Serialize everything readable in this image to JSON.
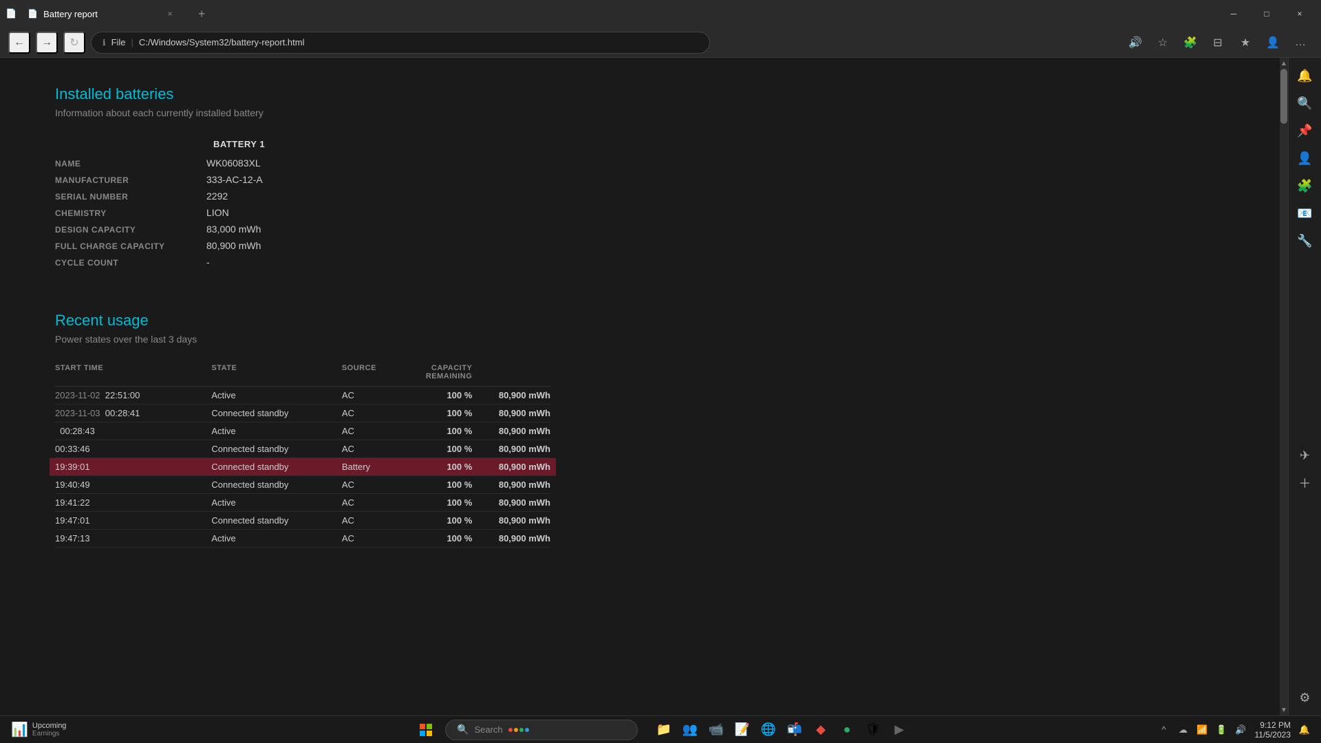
{
  "browser": {
    "tab": {
      "icon": "📄",
      "title": "Battery report",
      "close": "×"
    },
    "tab_new": "+",
    "address": {
      "lock_icon": "ℹ",
      "protocol": "File",
      "separator": "|",
      "path": "C:/Windows/System32/battery-report.html"
    },
    "nav": {
      "back": "←",
      "forward": "→",
      "refresh": "↻"
    },
    "toolbar": {
      "read_aloud": "🔊",
      "favorites": "☆",
      "extensions": "🧩",
      "split_view": "⊟",
      "collections": "★",
      "profile": "👤",
      "more": "…"
    },
    "title_controls": {
      "minimize": "─",
      "maximize": "□",
      "close": "×"
    }
  },
  "page": {
    "installed_batteries": {
      "title": "Installed batteries",
      "subtitle": "Information about each currently installed battery",
      "battery_header": "BATTERY 1",
      "rows": [
        {
          "label": "NAME",
          "value": "WK06083XL"
        },
        {
          "label": "MANUFACTURER",
          "value": "333-AC-12-A"
        },
        {
          "label": "SERIAL NUMBER",
          "value": "2292"
        },
        {
          "label": "CHEMISTRY",
          "value": "LION"
        },
        {
          "label": "DESIGN CAPACITY",
          "value": "83,000 mWh"
        },
        {
          "label": "FULL CHARGE CAPACITY",
          "value": "80,900 mWh"
        },
        {
          "label": "CYCLE COUNT",
          "value": "-"
        }
      ]
    },
    "recent_usage": {
      "title": "Recent usage",
      "subtitle": "Power states over the last 3 days",
      "columns": [
        "START TIME",
        "STATE",
        "SOURCE",
        "CAPACITY REMAINING",
        ""
      ],
      "rows": [
        {
          "date": "2023-11-02",
          "time": "22:51:00",
          "state": "Active",
          "source": "AC",
          "capacity": "100 %",
          "mwh": "80,900 mWh",
          "highlighted": false
        },
        {
          "date": "2023-11-03",
          "time": "00:28:41",
          "state": "Connected standby",
          "source": "AC",
          "capacity": "100 %",
          "mwh": "80,900 mWh",
          "highlighted": false
        },
        {
          "date": "",
          "time": "00:28:43",
          "state": "Active",
          "source": "AC",
          "capacity": "100 %",
          "mwh": "80,900 mWh",
          "highlighted": false
        },
        {
          "date": "",
          "time": "00:33:46",
          "state": "Connected standby",
          "source": "AC",
          "capacity": "100 %",
          "mwh": "80,900 mWh",
          "highlighted": false
        },
        {
          "date": "",
          "time": "19:39:01",
          "state": "Connected standby",
          "source": "Battery",
          "capacity": "100 %",
          "mwh": "80,900 mWh",
          "highlighted": true
        },
        {
          "date": "",
          "time": "19:40:49",
          "state": "Connected standby",
          "source": "AC",
          "capacity": "100 %",
          "mwh": "80,900 mWh",
          "highlighted": false
        },
        {
          "date": "",
          "time": "19:41:22",
          "state": "Active",
          "source": "AC",
          "capacity": "100 %",
          "mwh": "80,900 mWh",
          "highlighted": false
        },
        {
          "date": "",
          "time": "19:47:01",
          "state": "Connected standby",
          "source": "AC",
          "capacity": "100 %",
          "mwh": "80,900 mWh",
          "highlighted": false
        },
        {
          "date": "",
          "time": "19:47:13",
          "state": "Active",
          "source": "AC",
          "capacity": "100 %",
          "mwh": "80,900 mWh",
          "highlighted": false
        }
      ]
    }
  },
  "sidebar": {
    "icons": [
      {
        "name": "notifications",
        "symbol": "🔔",
        "color": ""
      },
      {
        "name": "search",
        "symbol": "🔍",
        "color": ""
      },
      {
        "name": "pin",
        "symbol": "📌",
        "color": "red"
      },
      {
        "name": "profile",
        "symbol": "👤",
        "color": "purple"
      },
      {
        "name": "extensions",
        "symbol": "🧩",
        "color": "teal"
      },
      {
        "name": "outlook",
        "symbol": "📧",
        "color": "blue"
      },
      {
        "name": "tools",
        "symbol": "🔧",
        "color": "orange"
      },
      {
        "name": "send",
        "symbol": "✈",
        "color": ""
      },
      {
        "name": "add",
        "symbol": "+",
        "color": ""
      }
    ]
  },
  "taskbar": {
    "left": {
      "app_name": "Upcoming",
      "app_sub": "Earnings"
    },
    "search_placeholder": "Search",
    "search_dots": [
      "#e74c3c",
      "#f39c12",
      "#27ae60",
      "#3498db"
    ],
    "apps": [
      {
        "name": "file-explorer",
        "symbol": "📁",
        "color": "#f39c12"
      },
      {
        "name": "teams",
        "symbol": "👥",
        "color": "#7b68ee"
      },
      {
        "name": "video",
        "symbol": "📹",
        "color": "#e74c3c"
      },
      {
        "name": "notes",
        "symbol": "📝",
        "color": "#f39c12"
      },
      {
        "name": "edge",
        "symbol": "🌐",
        "color": "#3498db"
      },
      {
        "name": "mail",
        "symbol": "📬",
        "color": "#3498db"
      },
      {
        "name": "app-red",
        "symbol": "◆",
        "color": "#e74c3c"
      },
      {
        "name": "app-green",
        "symbol": "●",
        "color": "#27ae60"
      },
      {
        "name": "app-shield",
        "symbol": "🛡",
        "color": "#c0392b"
      },
      {
        "name": "terminal",
        "symbol": "▶",
        "color": "#666"
      }
    ],
    "tray": {
      "chevron": "^",
      "cloud": "☁",
      "wifi": "📶",
      "battery": "🔋",
      "speaker": "🔊",
      "time": "9:12 PM",
      "date": "11/5/2023",
      "notification": "🔔"
    }
  }
}
